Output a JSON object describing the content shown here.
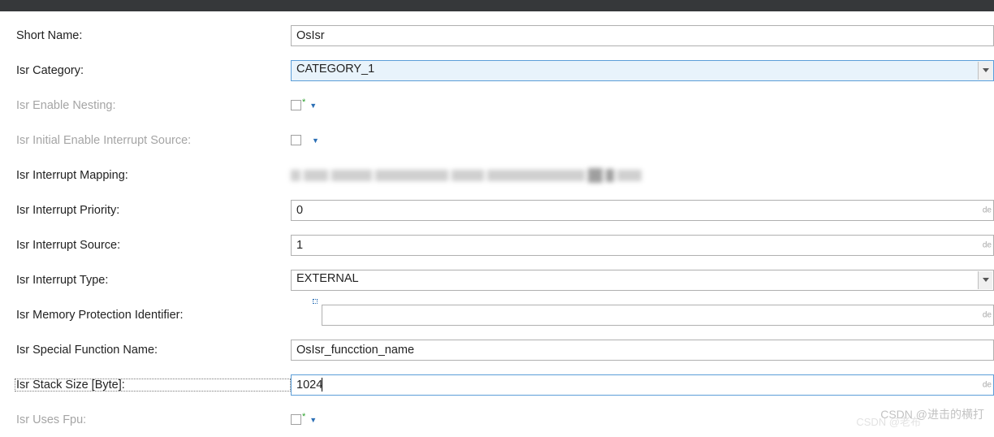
{
  "fields": {
    "short_name": {
      "label": "Short Name:",
      "value": "OsIsr"
    },
    "isr_category": {
      "label": "Isr Category:",
      "value": "CATEGORY_1"
    },
    "isr_enable_nesting": {
      "label": "Isr Enable Nesting:",
      "checked": false
    },
    "isr_initial_enable_interrupt_source": {
      "label": "Isr Initial Enable Interrupt Source:",
      "checked": false
    },
    "isr_interrupt_mapping": {
      "label": "Isr Interrupt Mapping:",
      "value": ""
    },
    "isr_interrupt_priority": {
      "label": "Isr Interrupt Priority:",
      "value": "0",
      "hint": "de"
    },
    "isr_interrupt_source": {
      "label": "Isr Interrupt Source:",
      "value": "1",
      "hint": "de"
    },
    "isr_interrupt_type": {
      "label": "Isr Interrupt Type:",
      "value": "EXTERNAL"
    },
    "isr_memory_protection_identifier": {
      "label": "Isr Memory Protection Identifier:",
      "value": "",
      "hint": "de"
    },
    "isr_special_function_name": {
      "label": "Isr Special Function Name:",
      "value": "OsIsr_funcction_name"
    },
    "isr_stack_size": {
      "label": "Isr Stack Size [Byte]:",
      "value": "1024",
      "hint": "de"
    },
    "isr_uses_fpu": {
      "label": "Isr Uses Fpu:",
      "checked": false
    }
  },
  "watermark": "CSDN @进击的横打",
  "watermark_faint": "CSDN @老布"
}
